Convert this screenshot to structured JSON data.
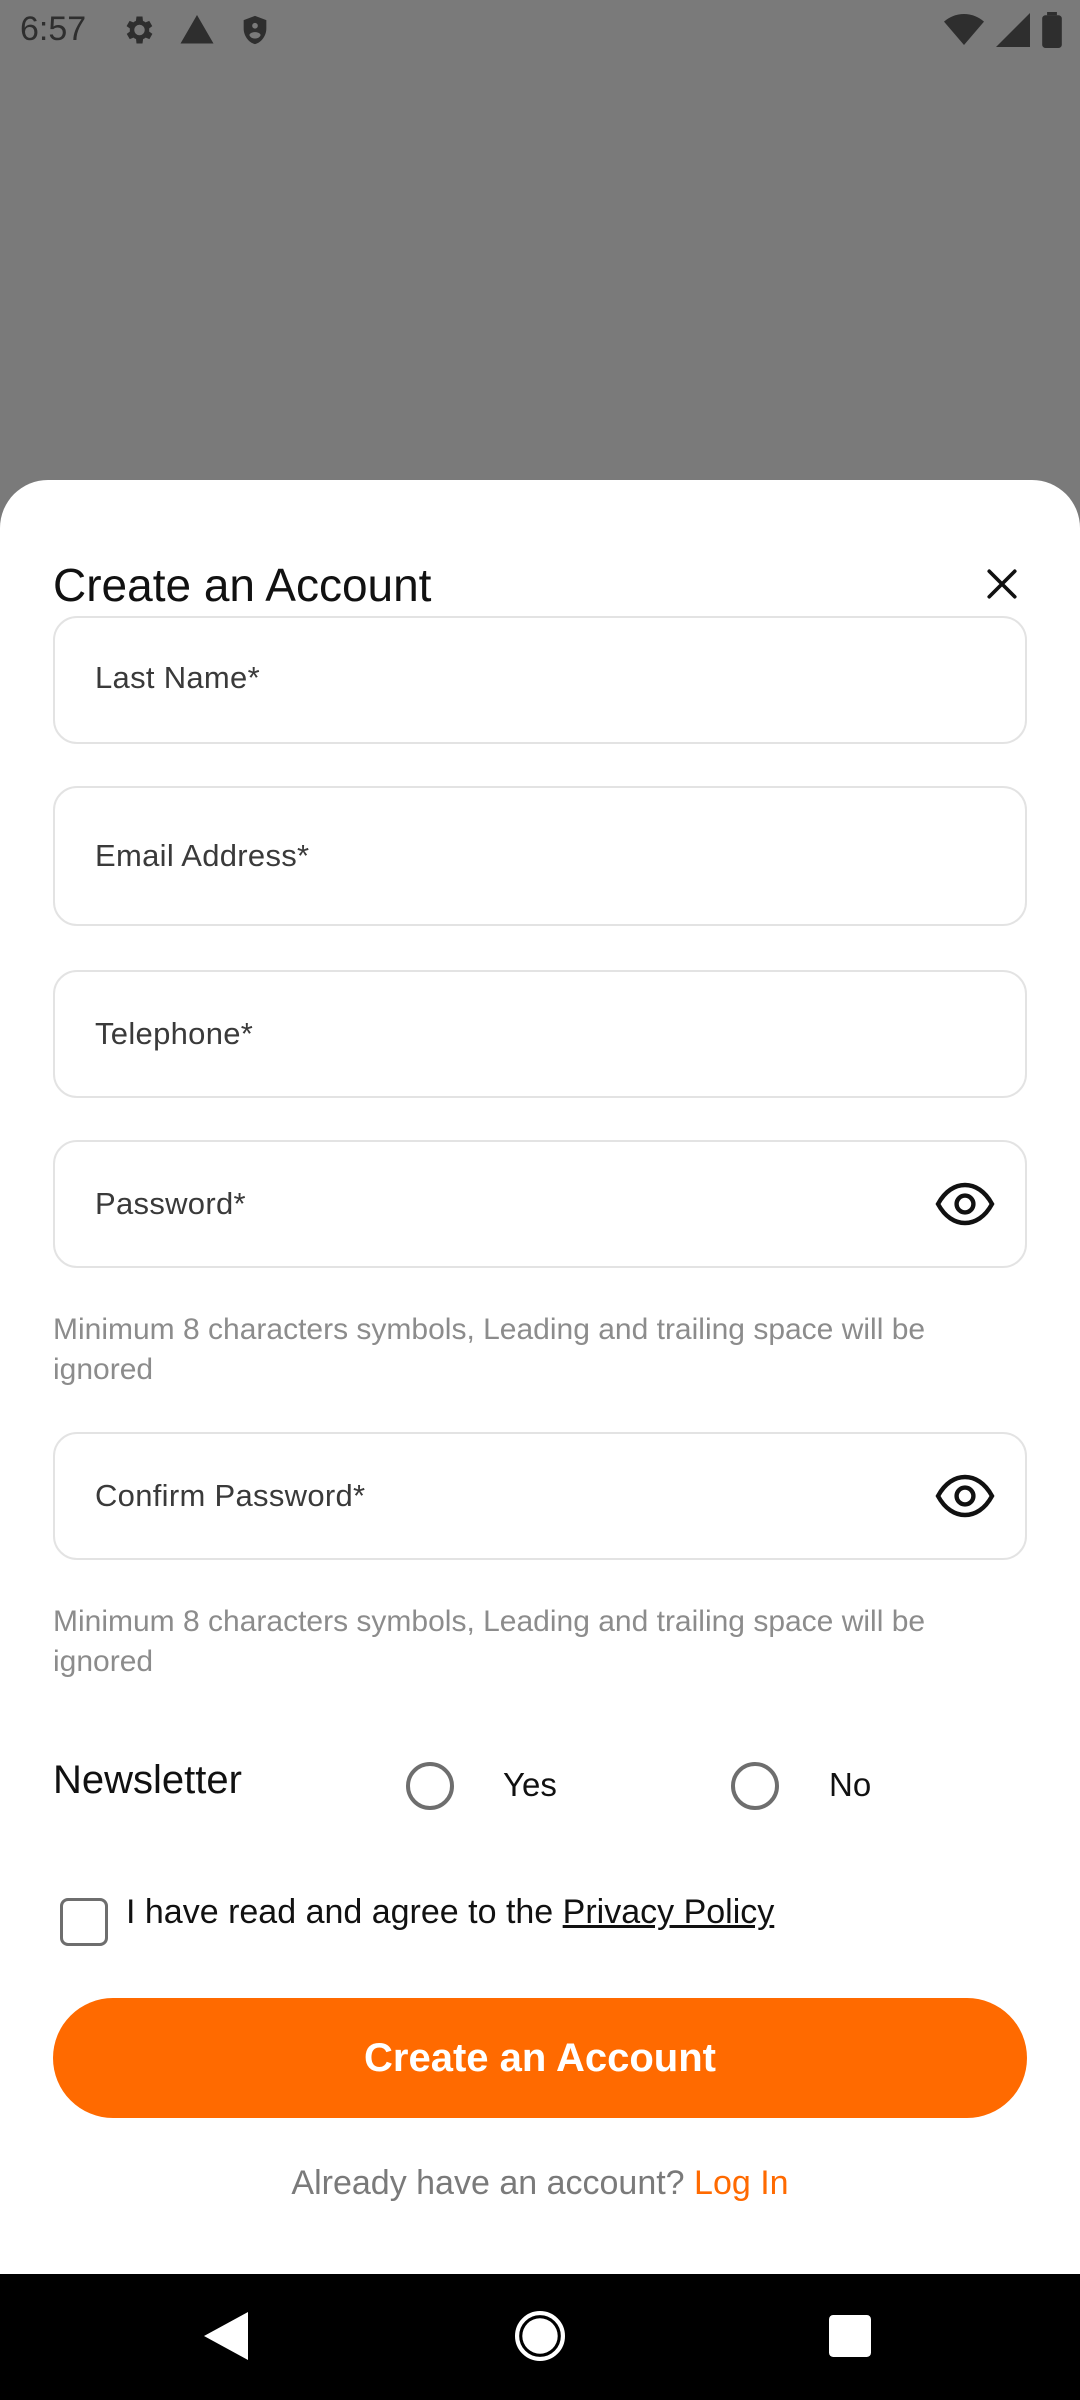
{
  "status_bar": {
    "time": "6:57",
    "icons": [
      "settings-icon",
      "alert-icon",
      "shield-icon",
      "wifi-icon",
      "signal-icon",
      "battery-icon"
    ]
  },
  "sheet": {
    "title": "Create an Account",
    "close_icon": "close-icon"
  },
  "form": {
    "last_name": {
      "label": "Last Name*"
    },
    "email": {
      "label": "Email Address*"
    },
    "telephone": {
      "label": "Telephone*"
    },
    "password": {
      "label": "Password*",
      "hint": "Minimum 8 characters symbols, Leading and trailing space will be ignored"
    },
    "confirm_password": {
      "label": "Confirm Password*",
      "hint": "Minimum 8 characters symbols, Leading and trailing space will be ignored"
    }
  },
  "newsletter": {
    "label": "Newsletter",
    "options": [
      {
        "label": "Yes",
        "selected": false
      },
      {
        "label": "No",
        "selected": false
      }
    ]
  },
  "agreement": {
    "text": "I have read and agree to the ",
    "link": "Privacy Policy",
    "checked": false
  },
  "submit": {
    "label": "Create an Account"
  },
  "login": {
    "prompt": "Already have an account? ",
    "link": "Log In"
  },
  "colors": {
    "accent": "#ff6a00",
    "overlay": "#7a7a7a",
    "border": "#e3e3e3",
    "hint": "#8c8c8c"
  }
}
